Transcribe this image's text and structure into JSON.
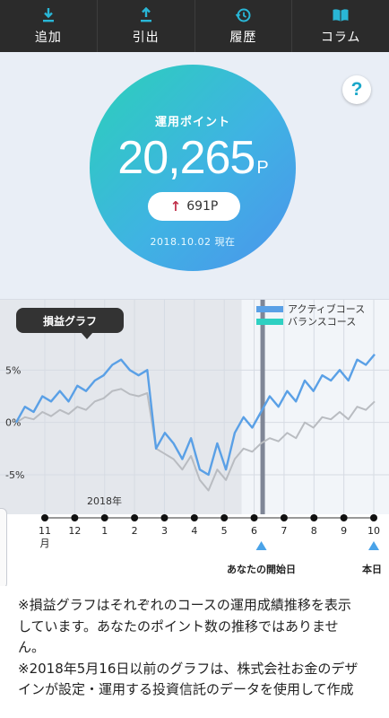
{
  "nav": {
    "items": [
      {
        "label": "追加",
        "icon": "download-icon"
      },
      {
        "label": "引出",
        "icon": "upload-icon"
      },
      {
        "label": "履歴",
        "icon": "history-icon"
      },
      {
        "label": "コラム",
        "icon": "book-icon"
      }
    ],
    "icon_color": "#29b6d6"
  },
  "help": {
    "label": "?"
  },
  "points": {
    "title": "運用ポイント",
    "value": "20,265",
    "unit": "P",
    "change": "691P",
    "change_direction": "up",
    "as_of": "2018.10.02 現在"
  },
  "chart": {
    "tag": "損益グラフ",
    "year_label": "2018年",
    "legend": [
      {
        "name": "アクティブコース",
        "color": "#5aa0e6"
      },
      {
        "name": "バランスコース",
        "color": "#2ed0c2"
      }
    ]
  },
  "chart_data": {
    "type": "line",
    "title": "損益グラフ",
    "y_ticks": [
      "5%",
      "0%",
      "-5%"
    ],
    "ylim": [
      -8,
      10
    ],
    "x_ticks": [
      "11月",
      "12",
      "1",
      "2",
      "3",
      "4",
      "5",
      "6",
      "7",
      "8",
      "9",
      "10"
    ],
    "year_label": "2018年",
    "start_marker": "あなたの開始日",
    "end_marker": "本日",
    "series": [
      {
        "name": "アクティブコース",
        "values": [
          0,
          1.5,
          1,
          2.5,
          2,
          3,
          2,
          3.5,
          3,
          4,
          4.5,
          5.5,
          6,
          5,
          4.5,
          5,
          -2.5,
          -1,
          -2,
          -3.5,
          -1.5,
          -4.5,
          -5,
          -2,
          -4.5,
          -1,
          0.5,
          -0.5,
          1,
          2.5,
          1.5,
          3,
          2,
          4,
          3,
          4.5,
          4,
          5,
          4,
          6,
          5.5,
          6.5
        ]
      },
      {
        "name": "バランスコース",
        "values": [
          0,
          0.5,
          0.3,
          1,
          0.6,
          1.2,
          0.8,
          1.5,
          1.2,
          2,
          2.3,
          3,
          3.2,
          2.7,
          2.5,
          2.8,
          -2.5,
          -3,
          -3.5,
          -4.5,
          -3.2,
          -5.5,
          -6.5,
          -4.5,
          -5.5,
          -3.5,
          -2.5,
          -2.8,
          -2,
          -1.5,
          -1.8,
          -1,
          -1.5,
          0,
          -0.5,
          0.5,
          0.3,
          1,
          0.3,
          1.5,
          1.2,
          2
        ]
      }
    ]
  },
  "notes": {
    "lines": [
      "※損益グラフはそれぞれのコースの運用成績推移を表示",
      "しています。あなたのポイント数の推移ではありませ",
      "ん。",
      "※2018年5月16日以前のグラフは、株式会社お金のデザ",
      "インが設定・運用する投資信託のデータを使用して作成"
    ]
  }
}
